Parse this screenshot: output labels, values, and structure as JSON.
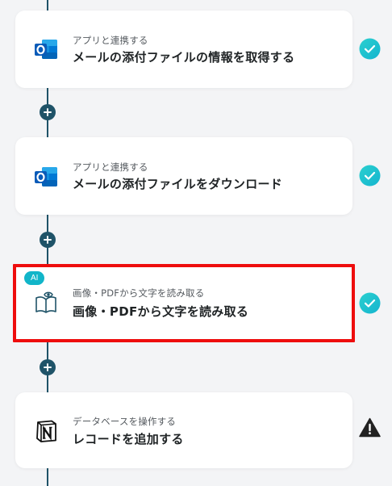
{
  "steps": [
    {
      "caption": "アプリと連携する",
      "title": "メールの添付ファイルの情報を取得する",
      "app_icon": "outlook-icon",
      "status": "completed"
    },
    {
      "caption": "アプリと連携する",
      "title": "メールの添付ファイルをダウンロード",
      "app_icon": "outlook-icon",
      "status": "completed"
    },
    {
      "badge": "AI",
      "caption": "画像・PDFから文字を読み取る",
      "title": "画像・PDFから文字を読み取る",
      "app_icon": "ocr-book-eye-icon",
      "status": "completed"
    },
    {
      "caption": "データベースを操作する",
      "title": "レコードを追加する",
      "app_icon": "notion-icon",
      "status": "warning"
    }
  ],
  "colors": {
    "background": "#f3f4f6",
    "flow_line": "#1f5368",
    "check_gradient_start": "#2bd0cf",
    "check_gradient_end": "#14b4cf",
    "highlight": "#ee0d0d",
    "ai_badge": "#11b5c9",
    "warning": "#222222"
  }
}
